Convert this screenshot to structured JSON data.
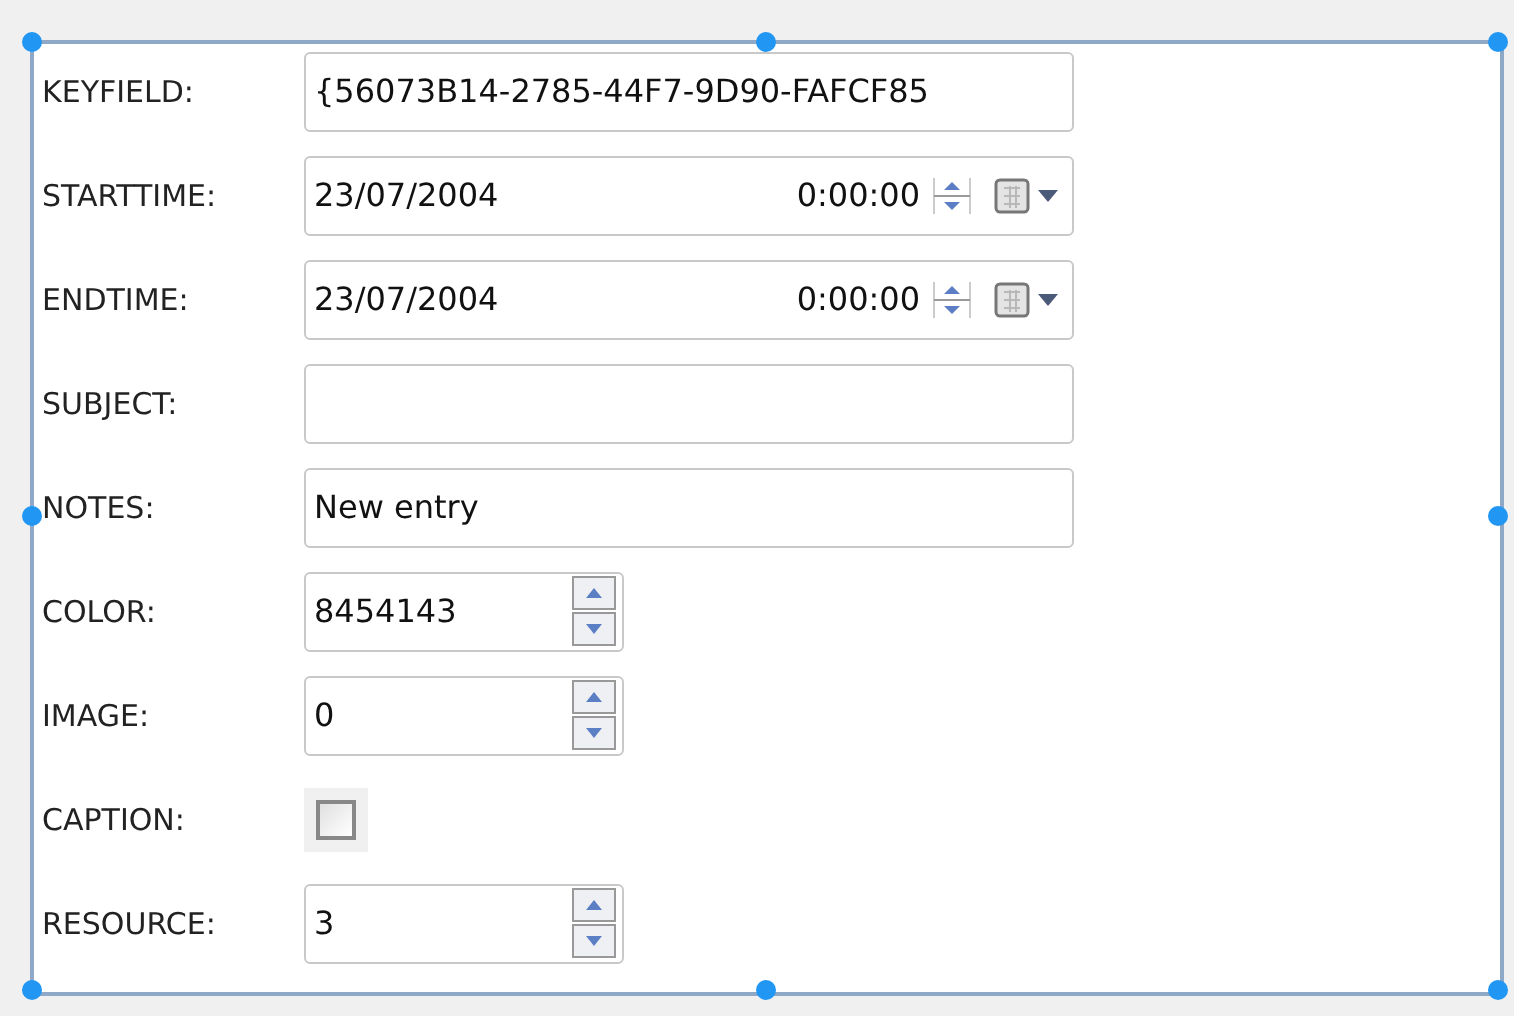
{
  "fields": [
    {
      "kind": "text",
      "label": "KEYFIELD:",
      "value": "{56073B14-2785-44F7-9D90-FAFCF85"
    },
    {
      "kind": "datetime",
      "label": "STARTTIME:",
      "date": "23/07/2004",
      "time": "0:00:00"
    },
    {
      "kind": "datetime",
      "label": "ENDTIME:",
      "date": "23/07/2004",
      "time": "0:00:00"
    },
    {
      "kind": "text",
      "label": "SUBJECT:"
    },
    {
      "kind": "text",
      "label": "NOTES:",
      "value": "New entry"
    },
    {
      "kind": "spin",
      "label": "COLOR:",
      "value": "8454143"
    },
    {
      "kind": "spin",
      "label": "IMAGE:",
      "value": "0"
    },
    {
      "kind": "checkbox",
      "label": "CAPTION:",
      "checked": false
    },
    {
      "kind": "spin",
      "label": "RESOURCE:",
      "value": "3"
    }
  ]
}
